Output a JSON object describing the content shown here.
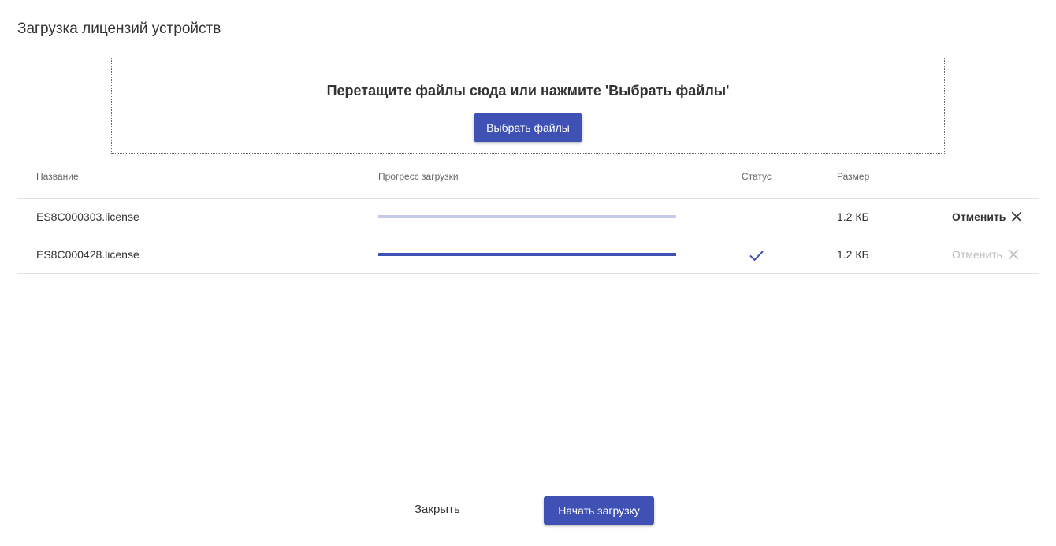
{
  "dialog": {
    "title": "Загрузка лицензий устройств"
  },
  "dropzone": {
    "text": "Перетащите файлы сюда или нажмите 'Выбрать файлы'",
    "choose_label": "Выбрать файлы"
  },
  "table": {
    "headers": {
      "name": "Название",
      "progress": "Прогресс загрузки",
      "status": "Статус",
      "size": "Размер"
    },
    "rows": [
      {
        "name": "ES8C000303.license",
        "progress": 0,
        "status": "",
        "size": "1.2 КБ",
        "cancel_label": "Отменить",
        "cancel_enabled": true
      },
      {
        "name": "ES8C000428.license",
        "progress": 100,
        "status": "check-icon",
        "size": "1.2 КБ",
        "cancel_label": "Отменить",
        "cancel_enabled": false
      }
    ]
  },
  "footer": {
    "close_label": "Закрыть",
    "start_label": "Начать загрузку"
  },
  "colors": {
    "primary": "#3f51b5",
    "progress_track": "#c5cae9",
    "disabled": "#bdbdbd"
  }
}
